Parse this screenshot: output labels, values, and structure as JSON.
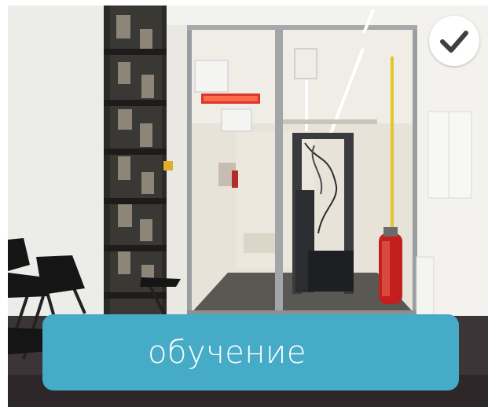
{
  "card": {
    "caption": "обучение",
    "check_icon": "checkmark-icon",
    "accent_color": "#45abc6",
    "photo_subject": "server-room-photo"
  }
}
